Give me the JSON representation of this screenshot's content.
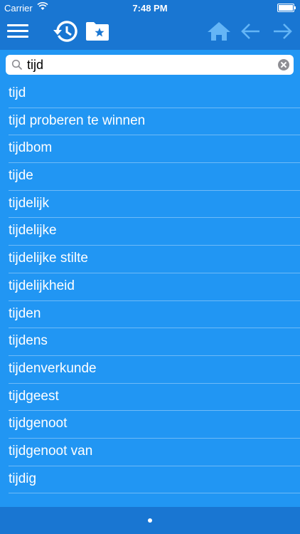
{
  "status": {
    "carrier": "Carrier",
    "time": "7:48 PM",
    "battery_level": 1.0
  },
  "toolbar": {
    "icons": [
      "menu-icon",
      "history-icon",
      "favorites-folder-icon",
      "home-icon",
      "arrow-back-icon",
      "arrow-forward-icon"
    ],
    "active_color": "#ffffff",
    "disabled_color": "#64b5f6"
  },
  "search": {
    "value": "tijd",
    "placeholder": ""
  },
  "results": [
    "tijd",
    "tijd proberen te winnen",
    "tijdbom",
    "tijde",
    "tijdelijk",
    "tijdelijke",
    "tijdelijke stilte",
    "tijdelijkheid",
    "tijden",
    "tijdens",
    "tijdenverkunde",
    "tijdgeest",
    "tijdgenoot",
    "tijdgenoot van",
    "tijdig"
  ],
  "colors": {
    "list_background": "#2196f3",
    "bar_background": "#1976d2"
  },
  "pager": {
    "current_page": 1,
    "total_pages": 1
  }
}
